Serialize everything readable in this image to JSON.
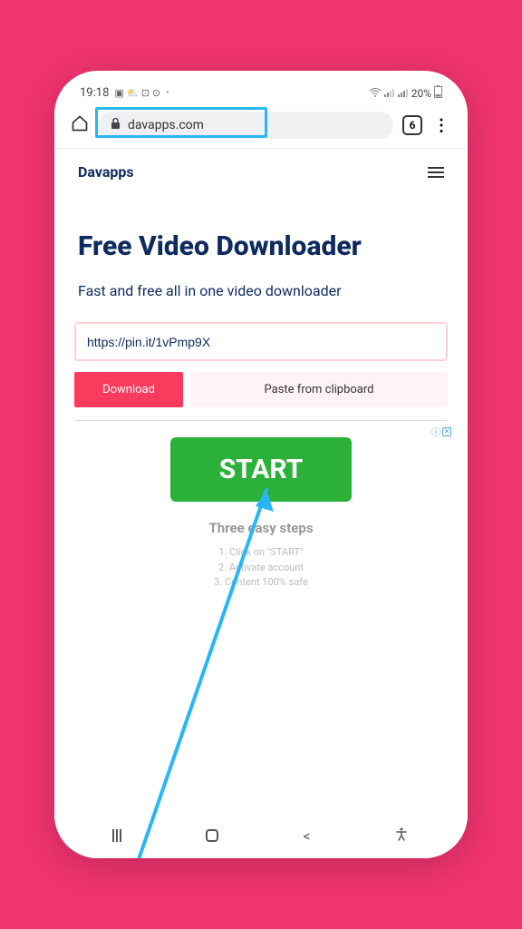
{
  "statusbar": {
    "time": "19:18",
    "battery": "20%",
    "icons_left": "▣ ⛅ ⊡ ⊙",
    "dot": "•"
  },
  "browser": {
    "url": "davapps.com",
    "tab_count": "6"
  },
  "site": {
    "brand": "Davapps",
    "hero_title": "Free Video Downloader",
    "hero_sub": "Fast and free all in one video downloader",
    "input_value": "https://pin.it/1vPmp9X",
    "download_label": "Download",
    "paste_label": "Paste from clipboard"
  },
  "ad": {
    "badge_info": "ⓘ",
    "badge_close": "✕",
    "start_label": "START",
    "subtitle": "Three easy steps",
    "step1": "1. Click on \"START\"",
    "step2": "2. Activate account",
    "step3": "3. Content 100% safe"
  }
}
